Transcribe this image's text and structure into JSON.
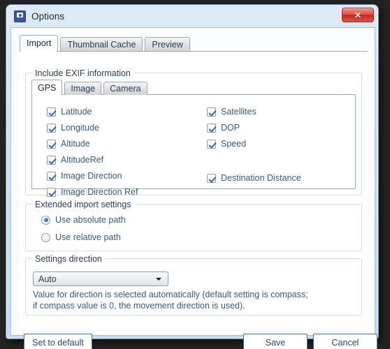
{
  "window": {
    "title": "Options",
    "icon": "camera-monitor-icon",
    "close_label": "✕",
    "colors": {
      "title_bar": "#cfe0f0",
      "close_button": "#c7251c",
      "label_text": "#3c5a77",
      "frame_border": "#6f8ba6"
    }
  },
  "tabs": [
    {
      "label": "Import",
      "active": true
    },
    {
      "label": "Thumbnail Cache",
      "active": false
    },
    {
      "label": "Preview",
      "active": false
    }
  ],
  "groups": {
    "exif": {
      "legend": "Include EXIF information"
    },
    "extended": {
      "legend": "Extended import settings"
    },
    "direction": {
      "legend": "Settings direction"
    }
  },
  "inner_tabs": [
    {
      "label": "GPS",
      "active": true
    },
    {
      "label": "Image",
      "active": false
    },
    {
      "label": "Camera",
      "active": false
    }
  ],
  "gps_checkboxes_left": [
    {
      "label": "Latitude",
      "checked": true
    },
    {
      "label": "Longitude",
      "checked": true
    },
    {
      "label": "Altitude",
      "checked": true
    },
    {
      "label": "AltitudeRef",
      "checked": true
    },
    {
      "label": "Image Direction",
      "checked": true
    },
    {
      "label": "Image Direction Ref",
      "checked": true
    }
  ],
  "gps_checkboxes_right": [
    {
      "label": "Satellites",
      "checked": true
    },
    {
      "label": "DOP",
      "checked": true
    },
    {
      "label": "Speed",
      "checked": true
    },
    {
      "label": "Destination Distance",
      "checked": true
    }
  ],
  "extended_settings": {
    "radios": [
      {
        "label": "Use absolute path",
        "selected": true
      },
      {
        "label": "Use relative path",
        "selected": false
      }
    ]
  },
  "settings_direction": {
    "combo_value": "Auto",
    "description_line1": "Value for direction is selected automatically (default setting is compass;",
    "description_line2": "if compass value is 0, the movement direction is used)."
  },
  "buttons": {
    "set_to_default": "Set to default",
    "save": "Save",
    "cancel": "Cancel"
  }
}
